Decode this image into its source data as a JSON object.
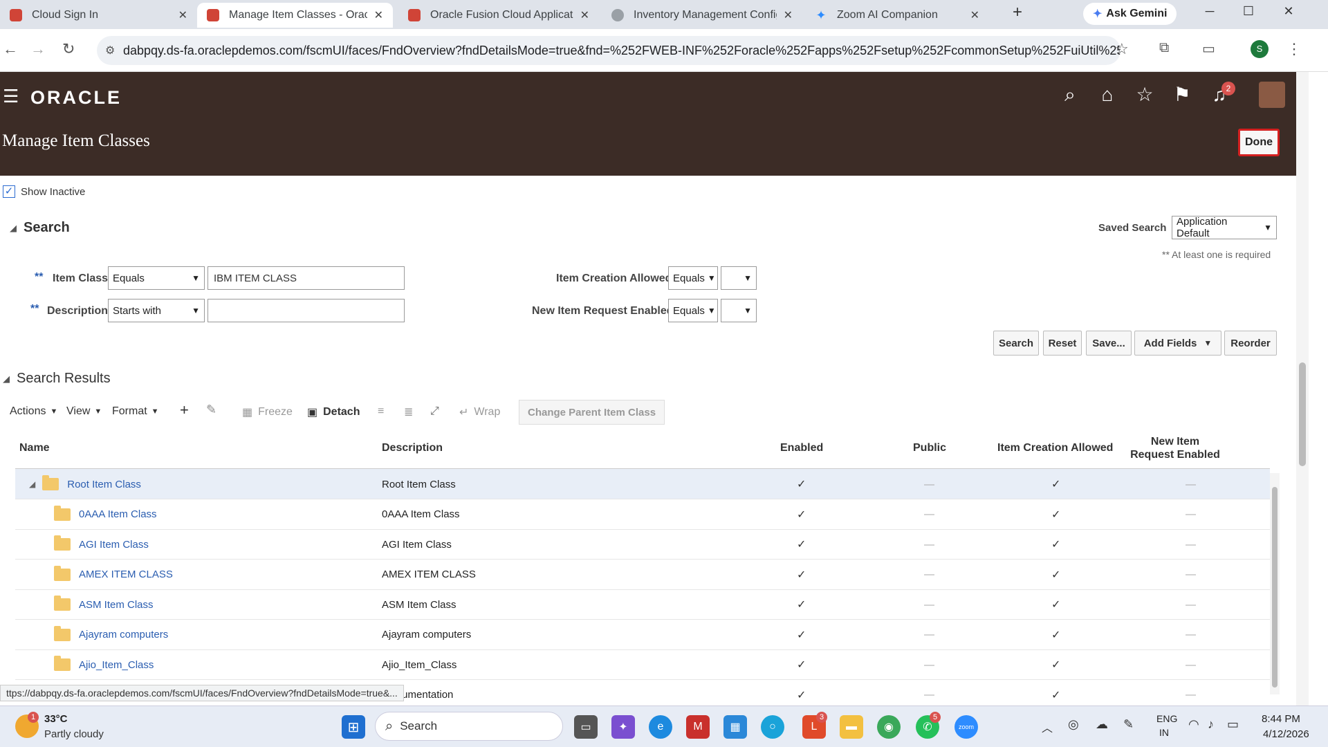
{
  "browser": {
    "tabs": [
      {
        "title": "Cloud Sign In",
        "fav_color": "#d04437"
      },
      {
        "title": "Manage Item Classes - Oracle",
        "fav_color": "#d04437"
      },
      {
        "title": "Oracle Fusion Cloud Applicatio",
        "fav_color": "#d04437"
      },
      {
        "title": "Inventory Management Config",
        "fav_color": "#9aa0a6"
      },
      {
        "title": "Zoom AI Companion",
        "fav_color": "#2d8cff"
      }
    ],
    "new_tab": "+",
    "gemini_label": "Ask Gemini",
    "url": "dabpqy.ds-fa.oraclepdemos.com/fscmUI/faces/FndOverview?fndDetailsMode=true&fnd=%252FWEB-INF%252Foracle%252Fapps%252Fsetup%252FcommonSetup%252FuiUtil%252F...",
    "profile_initial": "S"
  },
  "header": {
    "logo": "ORACLE",
    "page_title": "Manage Item Classes",
    "done_label": "Done",
    "notification_count": "2"
  },
  "show_inactive": {
    "label": "Show Inactive",
    "checked": true
  },
  "search": {
    "title": "Search",
    "saved_search_label": "Saved Search",
    "saved_search_value": "Application Default",
    "required_note": "** At least one is required",
    "required_mark": "**",
    "fields": {
      "item_class": {
        "label": "Item Class",
        "operator": "Equals",
        "value": "IBM ITEM CLASS"
      },
      "description": {
        "label": "Description",
        "operator": "Starts with",
        "value": ""
      },
      "item_creation_allowed": {
        "label": "Item Creation Allowed",
        "operator": "Equals",
        "value": ""
      },
      "new_item_request_enabled": {
        "label": "New Item Request Enabled",
        "operator": "Equals",
        "value": ""
      }
    },
    "buttons": {
      "search": "Search",
      "reset": "Reset",
      "save": "Save...",
      "add_fields": "Add Fields",
      "reorder": "Reorder"
    }
  },
  "results": {
    "title": "Search Results",
    "toolbar": {
      "actions": "Actions",
      "view": "View",
      "format": "Format",
      "freeze": "Freeze",
      "detach": "Detach",
      "wrap": "Wrap",
      "change_parent": "Change Parent Item Class"
    },
    "columns": [
      "Name",
      "Description",
      "Enabled",
      "Public",
      "Item Creation Allowed",
      "New Item Request Enabled"
    ],
    "rows": [
      {
        "name": "Root Item Class",
        "description": "Root Item Class",
        "enabled": "✓",
        "public": "—",
        "creation": "✓",
        "nir": "—"
      },
      {
        "name": "0AAA Item Class",
        "description": "0AAA Item Class",
        "enabled": "✓",
        "public": "—",
        "creation": "✓",
        "nir": "—"
      },
      {
        "name": "AGI Item Class",
        "description": "AGI Item Class",
        "enabled": "✓",
        "public": "—",
        "creation": "✓",
        "nir": "—"
      },
      {
        "name": "AMEX ITEM CLASS",
        "description": "AMEX ITEM CLASS",
        "enabled": "✓",
        "public": "—",
        "creation": "✓",
        "nir": "—"
      },
      {
        "name": "ASM Item Class",
        "description": "ASM Item Class",
        "enabled": "✓",
        "public": "—",
        "creation": "✓",
        "nir": "—"
      },
      {
        "name": "Ajayram computers",
        "description": "Ajayram computers",
        "enabled": "✓",
        "public": "—",
        "creation": "✓",
        "nir": "—"
      },
      {
        "name": "Ajio_Item_Class",
        "description": "Ajio_Item_Class",
        "enabled": "✓",
        "public": "—",
        "creation": "✓",
        "nir": "—"
      },
      {
        "name": "",
        "description": "Instrumentation",
        "enabled": "✓",
        "public": "—",
        "creation": "✓",
        "nir": "—"
      }
    ]
  },
  "status_url": "ttps://dabpqy.ds-fa.oraclepdemos.com/fscmUI/faces/FndOverview?fndDetailsMode=true&...",
  "taskbar": {
    "weather_temp": "33°C",
    "weather_desc": "Partly cloudy",
    "search_label": "Search",
    "lang_top": "ENG",
    "lang_bottom": "IN",
    "time": "8:44 PM",
    "date": "4/12/2026",
    "badge_office": "3",
    "badge_whatsapp": "5",
    "weather_badge": "1"
  }
}
